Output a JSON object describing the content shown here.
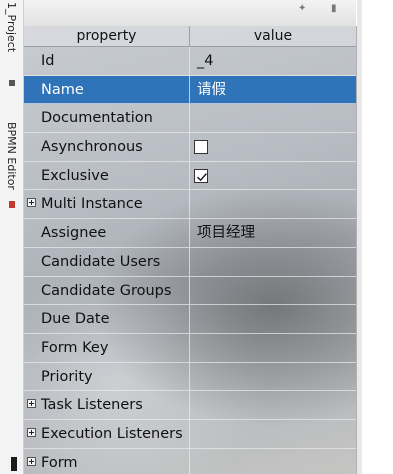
{
  "left_strip": {
    "project_tab": "1_Project",
    "editor_tab": "BPMN Editor"
  },
  "table": {
    "header_property": "property",
    "header_value": "value"
  },
  "rows": [
    {
      "label": "Id",
      "value": "_4",
      "kind": "text"
    },
    {
      "label": "Name",
      "value": "请假",
      "kind": "text",
      "selected": true
    },
    {
      "label": "Documentation",
      "value": "",
      "kind": "text"
    },
    {
      "label": "Asynchronous",
      "value": "",
      "kind": "checkbox",
      "checked": false
    },
    {
      "label": "Exclusive",
      "value": "",
      "kind": "checkbox",
      "checked": true
    },
    {
      "label": "Multi Instance",
      "value": "",
      "kind": "group"
    },
    {
      "label": "Assignee",
      "value": "项目经理",
      "kind": "text"
    },
    {
      "label": "Candidate Users",
      "value": "",
      "kind": "text"
    },
    {
      "label": "Candidate Groups",
      "value": "",
      "kind": "text"
    },
    {
      "label": "Due Date",
      "value": "",
      "kind": "text"
    },
    {
      "label": "Form Key",
      "value": "",
      "kind": "text"
    },
    {
      "label": "Priority",
      "value": "",
      "kind": "text"
    },
    {
      "label": "Task Listeners",
      "value": "",
      "kind": "group"
    },
    {
      "label": "Execution Listeners",
      "value": "",
      "kind": "group"
    },
    {
      "label": "Form",
      "value": "",
      "kind": "group"
    }
  ],
  "colors": {
    "selection": "#2f73b8"
  }
}
